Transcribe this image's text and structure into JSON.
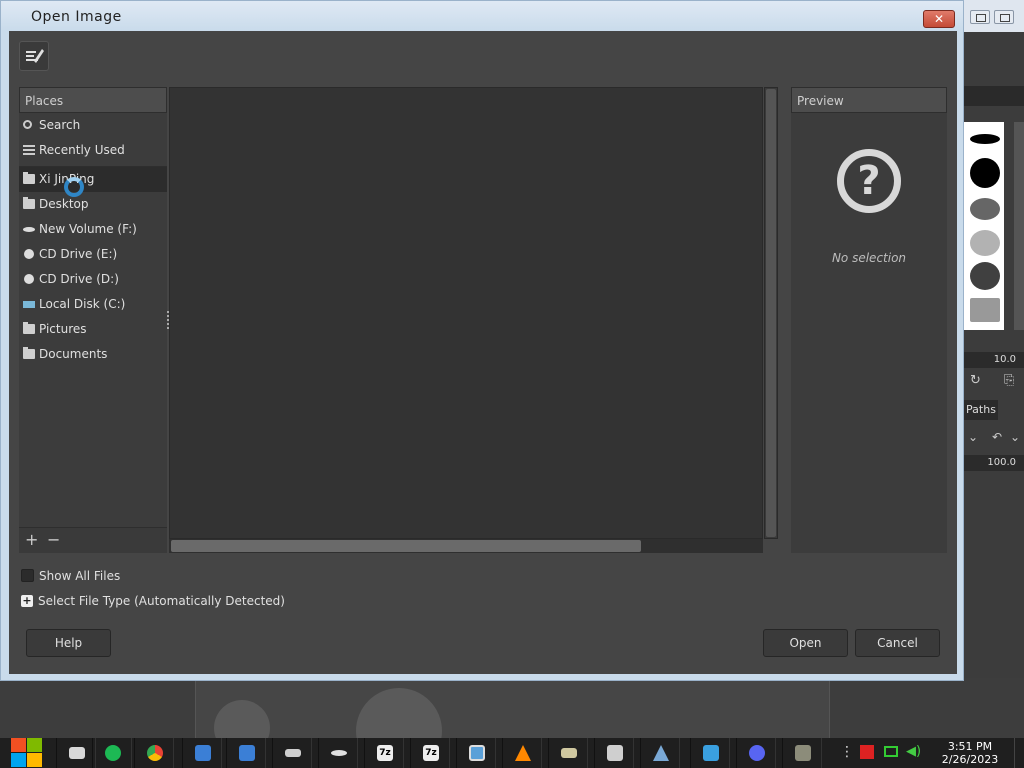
{
  "dialog": {
    "title": "Open Image",
    "close_glyph": "✕"
  },
  "places": {
    "header": "Places",
    "items": [
      {
        "label": "Search",
        "icon": "search-icon"
      },
      {
        "label": "Recently Used",
        "icon": "recent-icon"
      },
      {
        "label": "Xi JinPing",
        "icon": "folder-icon",
        "selected": true
      },
      {
        "label": "Desktop",
        "icon": "folder-icon"
      },
      {
        "label": "New Volume (F:)",
        "icon": "drive-icon"
      },
      {
        "label": "CD Drive (E:)",
        "icon": "cd-drive-icon"
      },
      {
        "label": "CD Drive (D:)",
        "icon": "cd-drive-icon"
      },
      {
        "label": "Local Disk (C:)",
        "icon": "local-disk-icon"
      },
      {
        "label": "Pictures",
        "icon": "folder-icon"
      },
      {
        "label": "Documents",
        "icon": "folder-icon"
      }
    ],
    "add_glyph": "+",
    "remove_glyph": "−"
  },
  "preview": {
    "header": "Preview",
    "question_glyph": "?",
    "empty_text": "No selection"
  },
  "options": {
    "show_all_files": "Show All Files",
    "show_all_checked": false,
    "select_file_type": "Select File Type (Automatically Detected)"
  },
  "buttons": {
    "help": "Help",
    "open": "Open",
    "cancel": "Cancel"
  },
  "background": {
    "paths_tab": "Paths",
    "spin1_value": "10.0",
    "spin2_value": "100.0"
  },
  "taskbar": {
    "time": "3:51 PM",
    "date": "2/26/2023",
    "apps": [
      "file-explorer",
      "spotify",
      "chrome",
      "app-blue-1",
      "app-blue-2",
      "app-drive",
      "app-drive-2",
      "7zip",
      "7zip-2",
      "image-viewer",
      "vlc",
      "scanner",
      "printer",
      "network-app",
      "app-sync",
      "discord",
      "gimp"
    ]
  },
  "colors": {
    "dialog_bg": "#454545",
    "accent_cursor": "#2f86c6",
    "close_button": "#c44a36"
  }
}
